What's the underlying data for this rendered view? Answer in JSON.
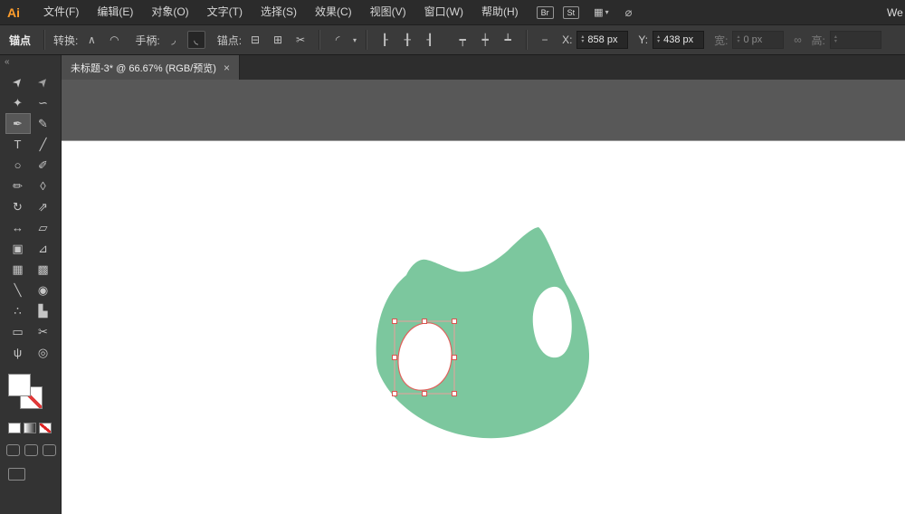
{
  "app": {
    "logo": "Ai",
    "workspace_right": "We"
  },
  "menubar": {
    "menus": [
      {
        "label": "文件(F)"
      },
      {
        "label": "编辑(E)"
      },
      {
        "label": "对象(O)"
      },
      {
        "label": "文字(T)"
      },
      {
        "label": "选择(S)"
      },
      {
        "label": "效果(C)"
      },
      {
        "label": "视图(V)"
      },
      {
        "label": "窗口(W)"
      },
      {
        "label": "帮助(H)"
      }
    ],
    "br_badge": "Br",
    "st_badge": "St",
    "workspace_icon": "▦",
    "workspace_caret": "▾",
    "extra_icon": "⌀"
  },
  "controlbar": {
    "context_label": "锚点",
    "convert_label": "转换:",
    "convert_corner_icon": "∧",
    "convert_smooth_icon": "◠",
    "handles_label": "手柄:",
    "handle_hide_icon": "◞",
    "handle_show_icon": "◟",
    "anchors_label": "锚点:",
    "anchor_remove_icon": "⊟",
    "anchor_add_icon": "⊞",
    "anchor_cut_icon": "✂",
    "corner_widget_icon": "◜",
    "caret": "▾",
    "align_h_left_icon": "┠",
    "align_h_center_icon": "╂",
    "align_h_right_icon": "┨",
    "align_v_top_icon": "┯",
    "align_v_middle_icon": "┿",
    "align_v_bottom_icon": "┷",
    "dash_icon": "−",
    "x_label": "X:",
    "x_value": "858 px",
    "y_label": "Y:",
    "y_value": "438 px",
    "w_label": "宽:",
    "w_value": "0 px",
    "link_icon": "∞",
    "h_label": "高:",
    "stepper_up": "▴",
    "stepper_down": "▾"
  },
  "tabbar": {
    "title": "未标题-3* @ 66.67% (RGB/预览)",
    "close": "×"
  },
  "toolbar": {
    "collapse_icon": "«",
    "tools": [
      {
        "name": "selection",
        "glyph": "➤"
      },
      {
        "name": "direct-selection",
        "glyph": "➤"
      },
      {
        "name": "magic-wand",
        "glyph": "✦"
      },
      {
        "name": "lasso",
        "glyph": "∽"
      },
      {
        "name": "pen",
        "glyph": "✒"
      },
      {
        "name": "curvature",
        "glyph": "✎"
      },
      {
        "name": "type",
        "glyph": "T"
      },
      {
        "name": "line",
        "glyph": "╱"
      },
      {
        "name": "ellipse",
        "glyph": "○"
      },
      {
        "name": "paintbrush",
        "glyph": "✐"
      },
      {
        "name": "shaper",
        "glyph": "✏"
      },
      {
        "name": "eraser",
        "glyph": "◊"
      },
      {
        "name": "rotate",
        "glyph": "↻"
      },
      {
        "name": "scale",
        "glyph": "⇗"
      },
      {
        "name": "width",
        "glyph": "↔"
      },
      {
        "name": "free-transform",
        "glyph": "▱"
      },
      {
        "name": "shape-builder",
        "glyph": "▣"
      },
      {
        "name": "perspective-grid",
        "glyph": "⊿"
      },
      {
        "name": "mesh",
        "glyph": "▦"
      },
      {
        "name": "gradient",
        "glyph": "▩"
      },
      {
        "name": "eyedropper",
        "glyph": "╲"
      },
      {
        "name": "blend",
        "glyph": "◉"
      },
      {
        "name": "symbol-sprayer",
        "glyph": "∴"
      },
      {
        "name": "column-graph",
        "glyph": "▙"
      },
      {
        "name": "artboard",
        "glyph": "▭"
      },
      {
        "name": "slice",
        "glyph": "✂"
      },
      {
        "name": "hand",
        "glyph": "ψ"
      },
      {
        "name": "zoom",
        "glyph": "◎"
      }
    ]
  },
  "canvas": {
    "colors": {
      "artboard": "#ffffff",
      "pasteboard": "#585858",
      "shape_green": "#7cc79e",
      "selection_path_red": "#e0625d",
      "selection_bbox_red": "#eb9f9b",
      "handle_fill": "#ffffff"
    }
  }
}
